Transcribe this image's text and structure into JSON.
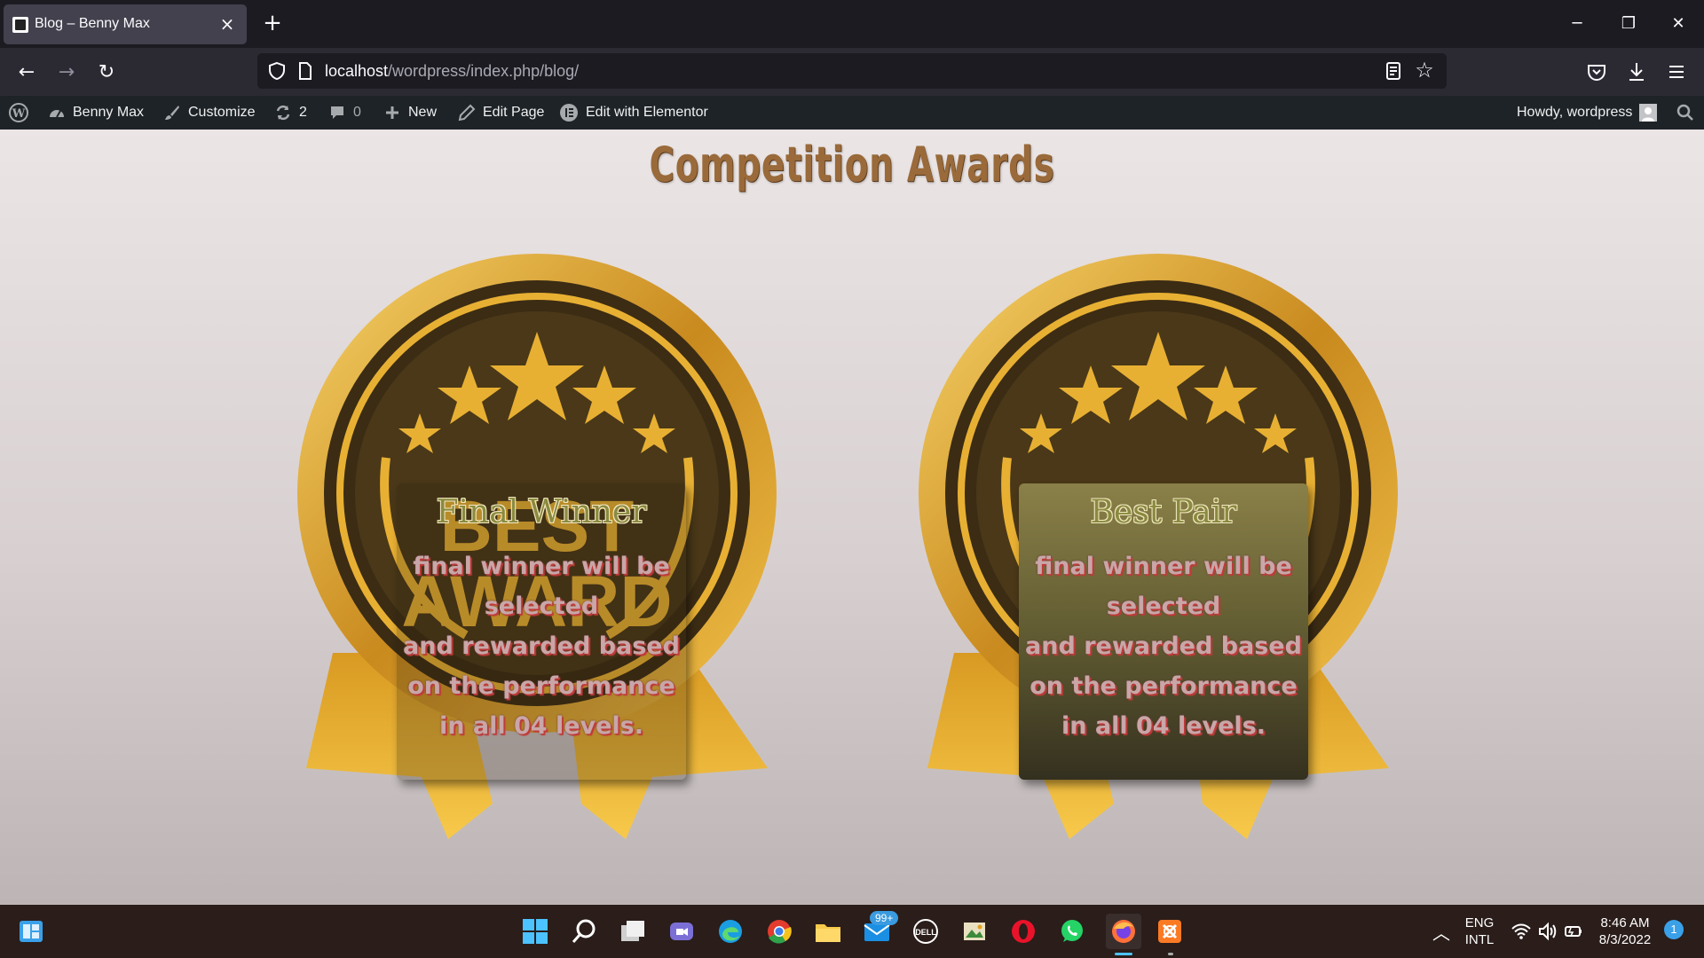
{
  "browser": {
    "tab_title": "Blog – Benny Max",
    "url_host": "localhost",
    "url_path": "/wordpress/index.php/blog/"
  },
  "adminbar": {
    "site_name": "Benny Max",
    "customize": "Customize",
    "updates_count": "2",
    "comments_count": "0",
    "new": "New",
    "edit_page": "Edit Page",
    "edit_elementor": "Edit with Elementor",
    "howdy": "Howdy, wordpress"
  },
  "page": {
    "title": "Competition Awards",
    "cards": [
      {
        "title": "Final Winner",
        "body": [
          "final winner will be",
          "selected",
          "and rewarded based",
          "on the performance",
          "in all 04 levels."
        ]
      },
      {
        "title": "Best Pair",
        "body": [
          "final winner will be",
          "selected",
          "and rewarded based",
          "on the performance",
          "in all 04 levels."
        ]
      }
    ],
    "medal_text": [
      "BEST",
      "AWARD"
    ]
  },
  "taskbar": {
    "mail_badge": "99+",
    "lang_top": "ENG",
    "lang_bottom": "INTL",
    "time": "8:46 AM",
    "date": "8/3/2022",
    "notification_count": "1"
  },
  "colors": {
    "title": "#9a6a3a",
    "gold": "#e8b033",
    "medal_dark": "#3c2c14"
  }
}
